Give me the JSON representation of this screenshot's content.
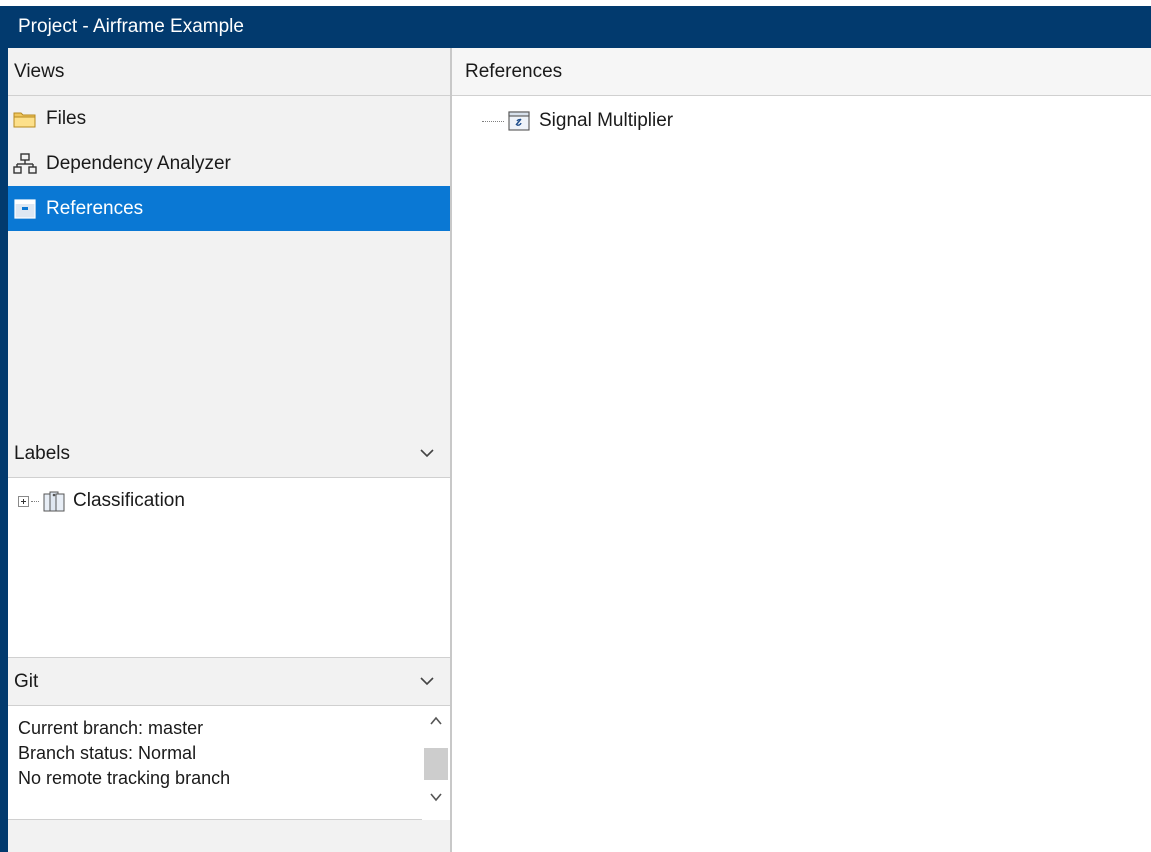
{
  "window": {
    "title": "Project - Airframe Example"
  },
  "views": {
    "header": "Views",
    "items": [
      {
        "label": "Files",
        "icon": "folder-icon",
        "selected": false
      },
      {
        "label": "Dependency Analyzer",
        "icon": "dependency-graph-icon",
        "selected": false
      },
      {
        "label": "References",
        "icon": "references-icon",
        "selected": true
      }
    ]
  },
  "labels": {
    "header": "Labels",
    "items": [
      {
        "label": "Classification",
        "icon": "label-tags-icon",
        "expanded": false
      }
    ]
  },
  "git": {
    "header": "Git",
    "lines": [
      "Current branch: master",
      "Branch status: Normal",
      "No remote tracking branch"
    ]
  },
  "references": {
    "header": "References",
    "items": [
      {
        "label": "Signal Multiplier",
        "icon": "project-reference-icon"
      }
    ]
  },
  "colors": {
    "titlebar": "#023a6e",
    "selection": "#0a78d4"
  }
}
